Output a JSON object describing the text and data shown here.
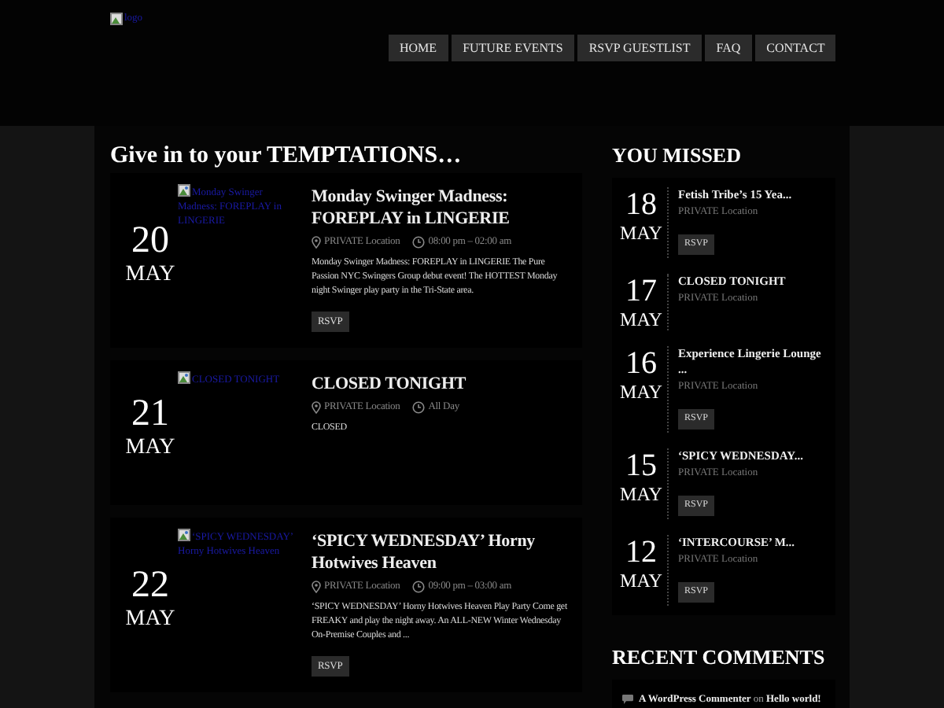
{
  "header": {
    "logo_alt": "logo",
    "nav": [
      {
        "label": "HOME"
      },
      {
        "label": "FUTURE EVENTS"
      },
      {
        "label": "RSVP GUESTLIST"
      },
      {
        "label": "FAQ"
      },
      {
        "label": "CONTACT"
      }
    ]
  },
  "main": {
    "title": "Give in to your TEMPTATIONS…",
    "events": [
      {
        "day": "20",
        "month": "MAY",
        "image_alt": "Monday Swinger Madness: FOREPLAY in LINGERIE",
        "title": "Monday Swinger Madness: FOREPLAY in LINGERIE",
        "location": "PRIVATE Location",
        "time": "08:00 pm – 02:00 am",
        "excerpt": "Monday Swinger Madness: FOREPLAY in LINGERIE The Pure Passion NYC Swingers Group debut event! The HOTTEST Monday night Swinger play party in the Tri-State area.",
        "button": "RSVP"
      },
      {
        "day": "21",
        "month": "MAY",
        "image_alt": "CLOSED TONIGHT",
        "title": "CLOSED TONIGHT",
        "location": "PRIVATE Location",
        "time": "All Day",
        "excerpt": "CLOSED"
      },
      {
        "day": "22",
        "month": "MAY",
        "image_alt": "‘SPICY WEDNESDAY’ Horny Hotwives Heaven",
        "title": "‘SPICY WEDNESDAY’ Horny Hotwives Heaven",
        "location": "PRIVATE Location",
        "time": "09:00 pm – 03:00 am",
        "excerpt": "‘SPICY WEDNESDAY’ Horny Hotwives Heaven Play Party Come get FREAKY and play the night away. An ALL-NEW Winter Wednesday On-Premise Couples and ...",
        "button": "RSVP"
      }
    ]
  },
  "sidebar": {
    "missed_title": "YOU MISSED",
    "missed": [
      {
        "day": "18",
        "month": "MAY",
        "title": "Fetish Tribe’s 15 Yea...",
        "location": "PRIVATE Location",
        "button": "RSVP"
      },
      {
        "day": "17",
        "month": "MAY",
        "title": "CLOSED TONIGHT",
        "location": "PRIVATE Location"
      },
      {
        "day": "16",
        "month": "MAY",
        "title": "Experience Lingerie Lounge ...",
        "location": "PRIVATE Location",
        "button": "RSVP"
      },
      {
        "day": "15",
        "month": "MAY",
        "title": "‘SPICY WEDNESDAY...",
        "location": "PRIVATE Location",
        "button": "RSVP"
      },
      {
        "day": "12",
        "month": "MAY",
        "title": "‘INTERCOURSE’ M...",
        "location": "PRIVATE Location",
        "button": "RSVP"
      }
    ],
    "comments_title": "RECENT COMMENTS",
    "comments": [
      {
        "author": "A WordPress Commenter",
        "joiner": "on",
        "post": "Hello world!"
      }
    ]
  }
}
